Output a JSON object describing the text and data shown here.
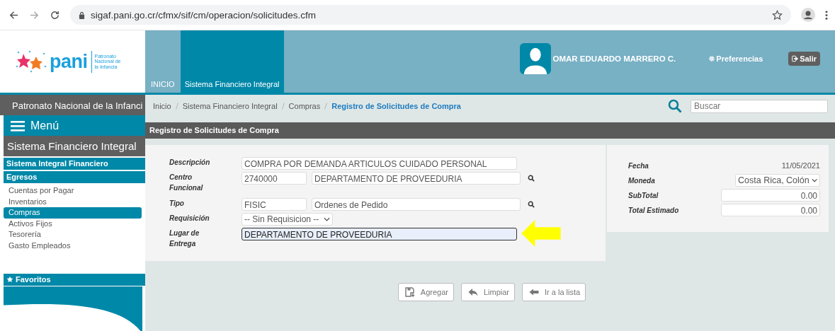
{
  "browser": {
    "url": "sigaf.pani.go.cr/cfmx/sif/cm/operacion/solicitudes.cfm"
  },
  "header": {
    "logo": {
      "name": "pani",
      "tagline": "Patronato Nacional de la Infancia"
    },
    "tabs": [
      {
        "label": "INICIO",
        "selected": false
      },
      {
        "label": "Sistema Financiero Integral",
        "selected": true
      }
    ],
    "user": "OMAR EDUARDO MARRERO C.",
    "preferences": "Preferencias",
    "logout": "Salir"
  },
  "sidebar": {
    "org_title": "Patronato Nacional de la Infanci",
    "menu_label": "Menú",
    "system_title": "Sistema Financiero Integral",
    "section": "Sistema Integral Financiero",
    "group": "Egresos",
    "items": [
      {
        "label": "Cuentas por Pagar",
        "selected": false
      },
      {
        "label": "Inventarios",
        "selected": false
      },
      {
        "label": "Compras",
        "selected": true
      },
      {
        "label": "Activos Fijos",
        "selected": false
      },
      {
        "label": "Tesorería",
        "selected": false
      },
      {
        "label": "Gasto Empleados",
        "selected": false
      }
    ],
    "favorites": "Favoritos"
  },
  "breadcrumb": {
    "items": [
      {
        "label": "Inicio",
        "selected": false
      },
      {
        "label": "Sistema Financiero Integral",
        "selected": false
      },
      {
        "label": "Compras",
        "selected": false
      },
      {
        "label": "Registro de Solicitudes de Compra",
        "selected": true
      }
    ],
    "search": {
      "placeholder": "Buscar"
    }
  },
  "form": {
    "title": "Registro de Solicitudes de Compra",
    "fields": [
      {
        "kind": "text",
        "label": "Descripción",
        "value": "COMPRA POR DEMANDA ARTICULOS CUIDADO PERSONAL",
        "focused": false
      },
      {
        "kind": "lookup",
        "label": "Centro Funcional",
        "code": "2740000",
        "value": "DEPARTAMENTO DE PROVEEDURIA"
      },
      {
        "kind": "lookup",
        "label": "Tipo",
        "code": "FISIC",
        "value": "Ordenes de Pedido"
      },
      {
        "kind": "select",
        "label": "Requisición",
        "value": "-- Sin Requisicion --"
      },
      {
        "kind": "text",
        "label": "Lugar de Entrega",
        "value": "DEPARTAMENTO DE PROVEEDURIA",
        "focused": true
      }
    ],
    "summary": [
      {
        "kind": "static",
        "label": "Fecha",
        "value": "11/05/2021"
      },
      {
        "kind": "select",
        "label": "Moneda",
        "value": "Costa Rica, Colón"
      },
      {
        "kind": "input",
        "label": "SubTotal",
        "value": "0.00"
      },
      {
        "kind": "input",
        "label": "Total Estimado",
        "value": "0.00"
      }
    ],
    "buttons": [
      "Agregar",
      "Limpiar",
      "Ir a la lista"
    ]
  }
}
